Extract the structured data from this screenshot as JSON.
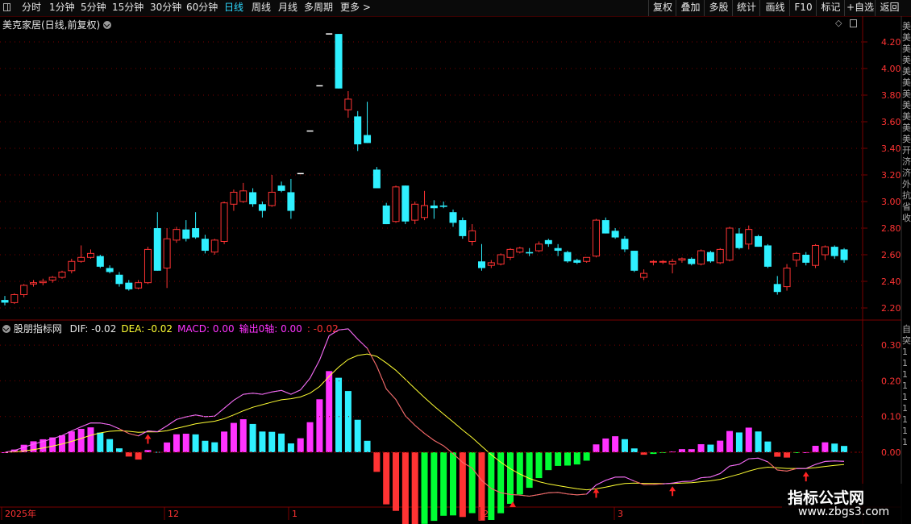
{
  "toolbar": {
    "periods": [
      "分时",
      "1分钟",
      "5分钟",
      "15分钟",
      "30分钟",
      "60分钟",
      "日线",
      "周线",
      "月线",
      "多周期",
      "更多 >"
    ],
    "active_period": "日线",
    "right_buttons": [
      "复权",
      "叠加",
      "多股",
      "统计",
      "画线",
      "F10",
      "标记",
      "+自选",
      "返回"
    ]
  },
  "main_chart": {
    "title": "美克家居(日线,前复权)",
    "price_ticks": [
      "4.20",
      "4.00",
      "3.80",
      "3.60",
      "3.40",
      "3.20",
      "3.00",
      "2.80",
      "2.60",
      "2.40",
      "2.20"
    ],
    "candles": [
      [
        2.26,
        2.29,
        2.22,
        2.24
      ],
      [
        2.24,
        2.31,
        2.23,
        2.3
      ],
      [
        2.3,
        2.38,
        2.28,
        2.37
      ],
      [
        2.38,
        2.41,
        2.36,
        2.39
      ],
      [
        2.39,
        2.42,
        2.37,
        2.4
      ],
      [
        2.41,
        2.44,
        2.39,
        2.43
      ],
      [
        2.43,
        2.48,
        2.42,
        2.47
      ],
      [
        2.48,
        2.57,
        2.46,
        2.55
      ],
      [
        2.55,
        2.67,
        2.54,
        2.58
      ],
      [
        2.58,
        2.64,
        2.57,
        2.61
      ],
      [
        2.59,
        2.6,
        2.5,
        2.51
      ],
      [
        2.5,
        2.52,
        2.46,
        2.47
      ],
      [
        2.45,
        2.47,
        2.36,
        2.38
      ],
      [
        2.39,
        2.41,
        2.33,
        2.34
      ],
      [
        2.35,
        2.41,
        2.34,
        2.39
      ],
      [
        2.39,
        2.66,
        2.38,
        2.64
      ],
      [
        2.8,
        2.92,
        2.48,
        2.48
      ],
      [
        2.5,
        2.8,
        2.35,
        2.72
      ],
      [
        2.71,
        2.81,
        2.69,
        2.79
      ],
      [
        2.79,
        2.86,
        2.7,
        2.72
      ],
      [
        2.8,
        2.92,
        2.72,
        2.73
      ],
      [
        2.72,
        2.75,
        2.61,
        2.63
      ],
      [
        2.62,
        2.72,
        2.6,
        2.71
      ],
      [
        2.7,
        3.0,
        2.68,
        2.99
      ],
      [
        2.98,
        3.09,
        2.93,
        3.07
      ],
      [
        3.0,
        3.14,
        2.99,
        3.08
      ],
      [
        3.07,
        3.1,
        2.96,
        2.98
      ],
      [
        2.98,
        3.0,
        2.88,
        2.93
      ],
      [
        2.97,
        3.2,
        2.96,
        3.07
      ],
      [
        3.12,
        3.15,
        3.07,
        3.08
      ],
      [
        3.07,
        3.17,
        2.87,
        2.93
      ],
      [
        3.21,
        3.21,
        3.21,
        3.21
      ],
      [
        3.53,
        3.53,
        3.53,
        3.53
      ],
      [
        3.87,
        3.87,
        3.87,
        3.87
      ],
      [
        4.26,
        4.26,
        4.26,
        4.26
      ],
      [
        4.26,
        4.26,
        3.85,
        3.85
      ],
      [
        3.69,
        3.83,
        3.63,
        3.77
      ],
      [
        3.64,
        3.68,
        3.38,
        3.43
      ],
      [
        3.5,
        3.75,
        3.44,
        3.44
      ],
      [
        3.24,
        3.26,
        3.1,
        3.1
      ],
      [
        2.97,
        2.99,
        2.83,
        2.83
      ],
      [
        2.85,
        3.12,
        2.84,
        3.11
      ],
      [
        3.12,
        3.12,
        2.83,
        2.85
      ],
      [
        2.86,
        3.0,
        2.83,
        2.98
      ],
      [
        2.88,
        3.08,
        2.86,
        2.97
      ],
      [
        2.97,
        3.01,
        2.87,
        2.95
      ],
      [
        2.97,
        3.0,
        2.95,
        2.96
      ],
      [
        2.92,
        2.94,
        2.81,
        2.84
      ],
      [
        2.86,
        2.88,
        2.72,
        2.74
      ],
      [
        2.7,
        2.83,
        2.67,
        2.78
      ],
      [
        2.55,
        2.68,
        2.48,
        2.5
      ],
      [
        2.52,
        2.56,
        2.5,
        2.54
      ],
      [
        2.53,
        2.61,
        2.52,
        2.6
      ],
      [
        2.58,
        2.65,
        2.56,
        2.64
      ],
      [
        2.62,
        2.66,
        2.61,
        2.65
      ],
      [
        2.62,
        2.65,
        2.59,
        2.61
      ],
      [
        2.63,
        2.7,
        2.62,
        2.68
      ],
      [
        2.71,
        2.72,
        2.66,
        2.68
      ],
      [
        2.65,
        2.68,
        2.59,
        2.63
      ],
      [
        2.62,
        2.63,
        2.54,
        2.55
      ],
      [
        2.56,
        2.57,
        2.53,
        2.54
      ],
      [
        2.55,
        2.58,
        2.54,
        2.58
      ],
      [
        2.59,
        2.87,
        2.58,
        2.86
      ],
      [
        2.86,
        2.88,
        2.76,
        2.76
      ],
      [
        2.78,
        2.8,
        2.72,
        2.73
      ],
      [
        2.72,
        2.74,
        2.62,
        2.64
      ],
      [
        2.63,
        2.63,
        2.47,
        2.48
      ],
      [
        2.43,
        2.49,
        2.41,
        2.46
      ],
      [
        2.55,
        2.56,
        2.52,
        2.55
      ],
      [
        2.55,
        2.56,
        2.53,
        2.55
      ],
      [
        2.53,
        2.57,
        2.46,
        2.55
      ],
      [
        2.56,
        2.58,
        2.54,
        2.57
      ],
      [
        2.57,
        2.58,
        2.52,
        2.53
      ],
      [
        2.53,
        2.64,
        2.52,
        2.63
      ],
      [
        2.62,
        2.63,
        2.54,
        2.55
      ],
      [
        2.54,
        2.65,
        2.53,
        2.64
      ],
      [
        2.56,
        2.81,
        2.55,
        2.8
      ],
      [
        2.76,
        2.8,
        2.64,
        2.65
      ],
      [
        2.68,
        2.82,
        2.64,
        2.79
      ],
      [
        2.74,
        2.75,
        2.66,
        2.66
      ],
      [
        2.67,
        2.68,
        2.5,
        2.51
      ],
      [
        2.38,
        2.44,
        2.3,
        2.32
      ],
      [
        2.36,
        2.53,
        2.33,
        2.5
      ],
      [
        2.56,
        2.62,
        2.51,
        2.61
      ],
      [
        2.6,
        2.62,
        2.52,
        2.54
      ],
      [
        2.52,
        2.68,
        2.5,
        2.67
      ],
      [
        2.6,
        2.67,
        2.56,
        2.66
      ],
      [
        2.66,
        2.67,
        2.57,
        2.59
      ],
      [
        2.64,
        2.65,
        2.54,
        2.56
      ]
    ],
    "right_labels": [
      "美",
      "美",
      "美",
      "美",
      "美",
      "美",
      "美",
      "美",
      "美",
      "美",
      "美",
      "开",
      "济",
      "济",
      "外",
      "抗",
      "省",
      "收"
    ]
  },
  "indicator": {
    "title": "股朋指标网",
    "values": [
      {
        "text": "DIF: -0.02",
        "color": "#e6e6e6"
      },
      {
        "text": "DEA: -0.02",
        "color": "#ffff33"
      },
      {
        "text": "MACD: 0.00",
        "color": "#ff33ff"
      },
      {
        "text": "输出0轴: 0.00",
        "color": "#ff33ff"
      },
      {
        "text": ": -0.02",
        "color": "#ff3333"
      }
    ],
    "axis_ticks": [
      "0.30",
      "0.20",
      "0.10",
      "0.00"
    ],
    "date_labels": [
      "2025年",
      "12",
      "1",
      "2",
      "3"
    ],
    "right_labels": [
      "自",
      "突",
      "1",
      "1",
      "1",
      "1",
      "1",
      "1",
      "1",
      "1",
      "1"
    ]
  },
  "watermark": {
    "title": "指标公式网",
    "url": "www.zbgs3.com"
  },
  "colors": {
    "up": "#ff3333",
    "down": "#2ff0ff",
    "dif": "#e6e6e6",
    "dea": "#ffff33",
    "macd_pos": "#ff33ff",
    "macd_neg": "#00ff33",
    "grid": "#7a0000",
    "active_tab": "#2fd9ff"
  }
}
